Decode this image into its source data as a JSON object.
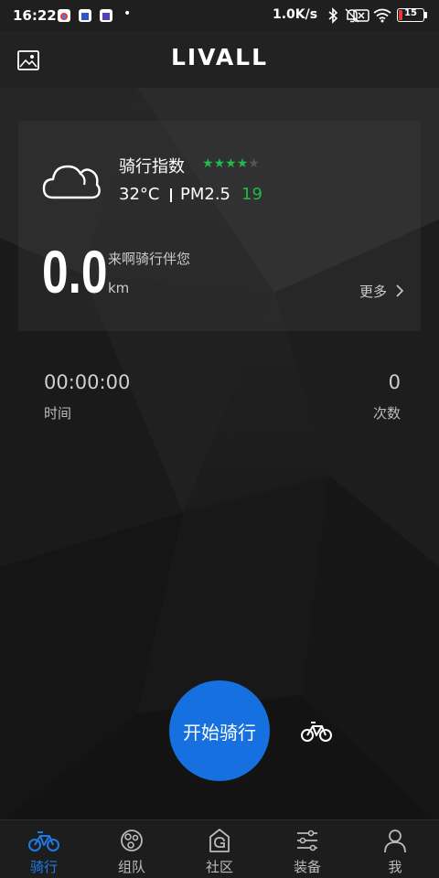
{
  "status_bar": {
    "time": "16:22",
    "network_speed": "1.0K/s",
    "battery_level": "15",
    "battery_fraction": 0.15,
    "icons": [
      "app-icon",
      "app-icon",
      "app-icon",
      "bluetooth-icon",
      "mute-icon",
      "sim-off-icon",
      "wifi-icon",
      "battery-icon"
    ]
  },
  "header": {
    "logo": "LIVALL",
    "left_icon": "gallery-icon"
  },
  "card": {
    "ride_index_label": "骑行指数",
    "ride_index_stars": 4,
    "ride_index_max": 5,
    "stars_colors": {
      "on": "#22b94a",
      "off": "#555555"
    },
    "temperature": "32°C",
    "pm_label": "PM2.5",
    "pm_value": "19",
    "pm_color": "#22b94a",
    "weather_icon": "cloud-icon",
    "distance": "0.0",
    "slogan": "来啊骑行伴您",
    "unit": "km",
    "more": "更多"
  },
  "stats": {
    "duration": "00:00:00",
    "duration_label": "时间",
    "count": "0",
    "count_label": "次数"
  },
  "start_button": {
    "label": "开始骑行",
    "color": "#1670e0"
  },
  "bike_type_icon": "bicycle-icon",
  "nav": {
    "active_color": "#1d7ae6",
    "items": [
      {
        "label": "骑行",
        "icon": "bicycle-icon",
        "active": true
      },
      {
        "label": "组队",
        "icon": "team-icon",
        "active": false
      },
      {
        "label": "社区",
        "icon": "community-icon",
        "active": false
      },
      {
        "label": "装备",
        "icon": "equipment-icon",
        "active": false
      },
      {
        "label": "我",
        "icon": "profile-icon",
        "active": false
      }
    ]
  }
}
